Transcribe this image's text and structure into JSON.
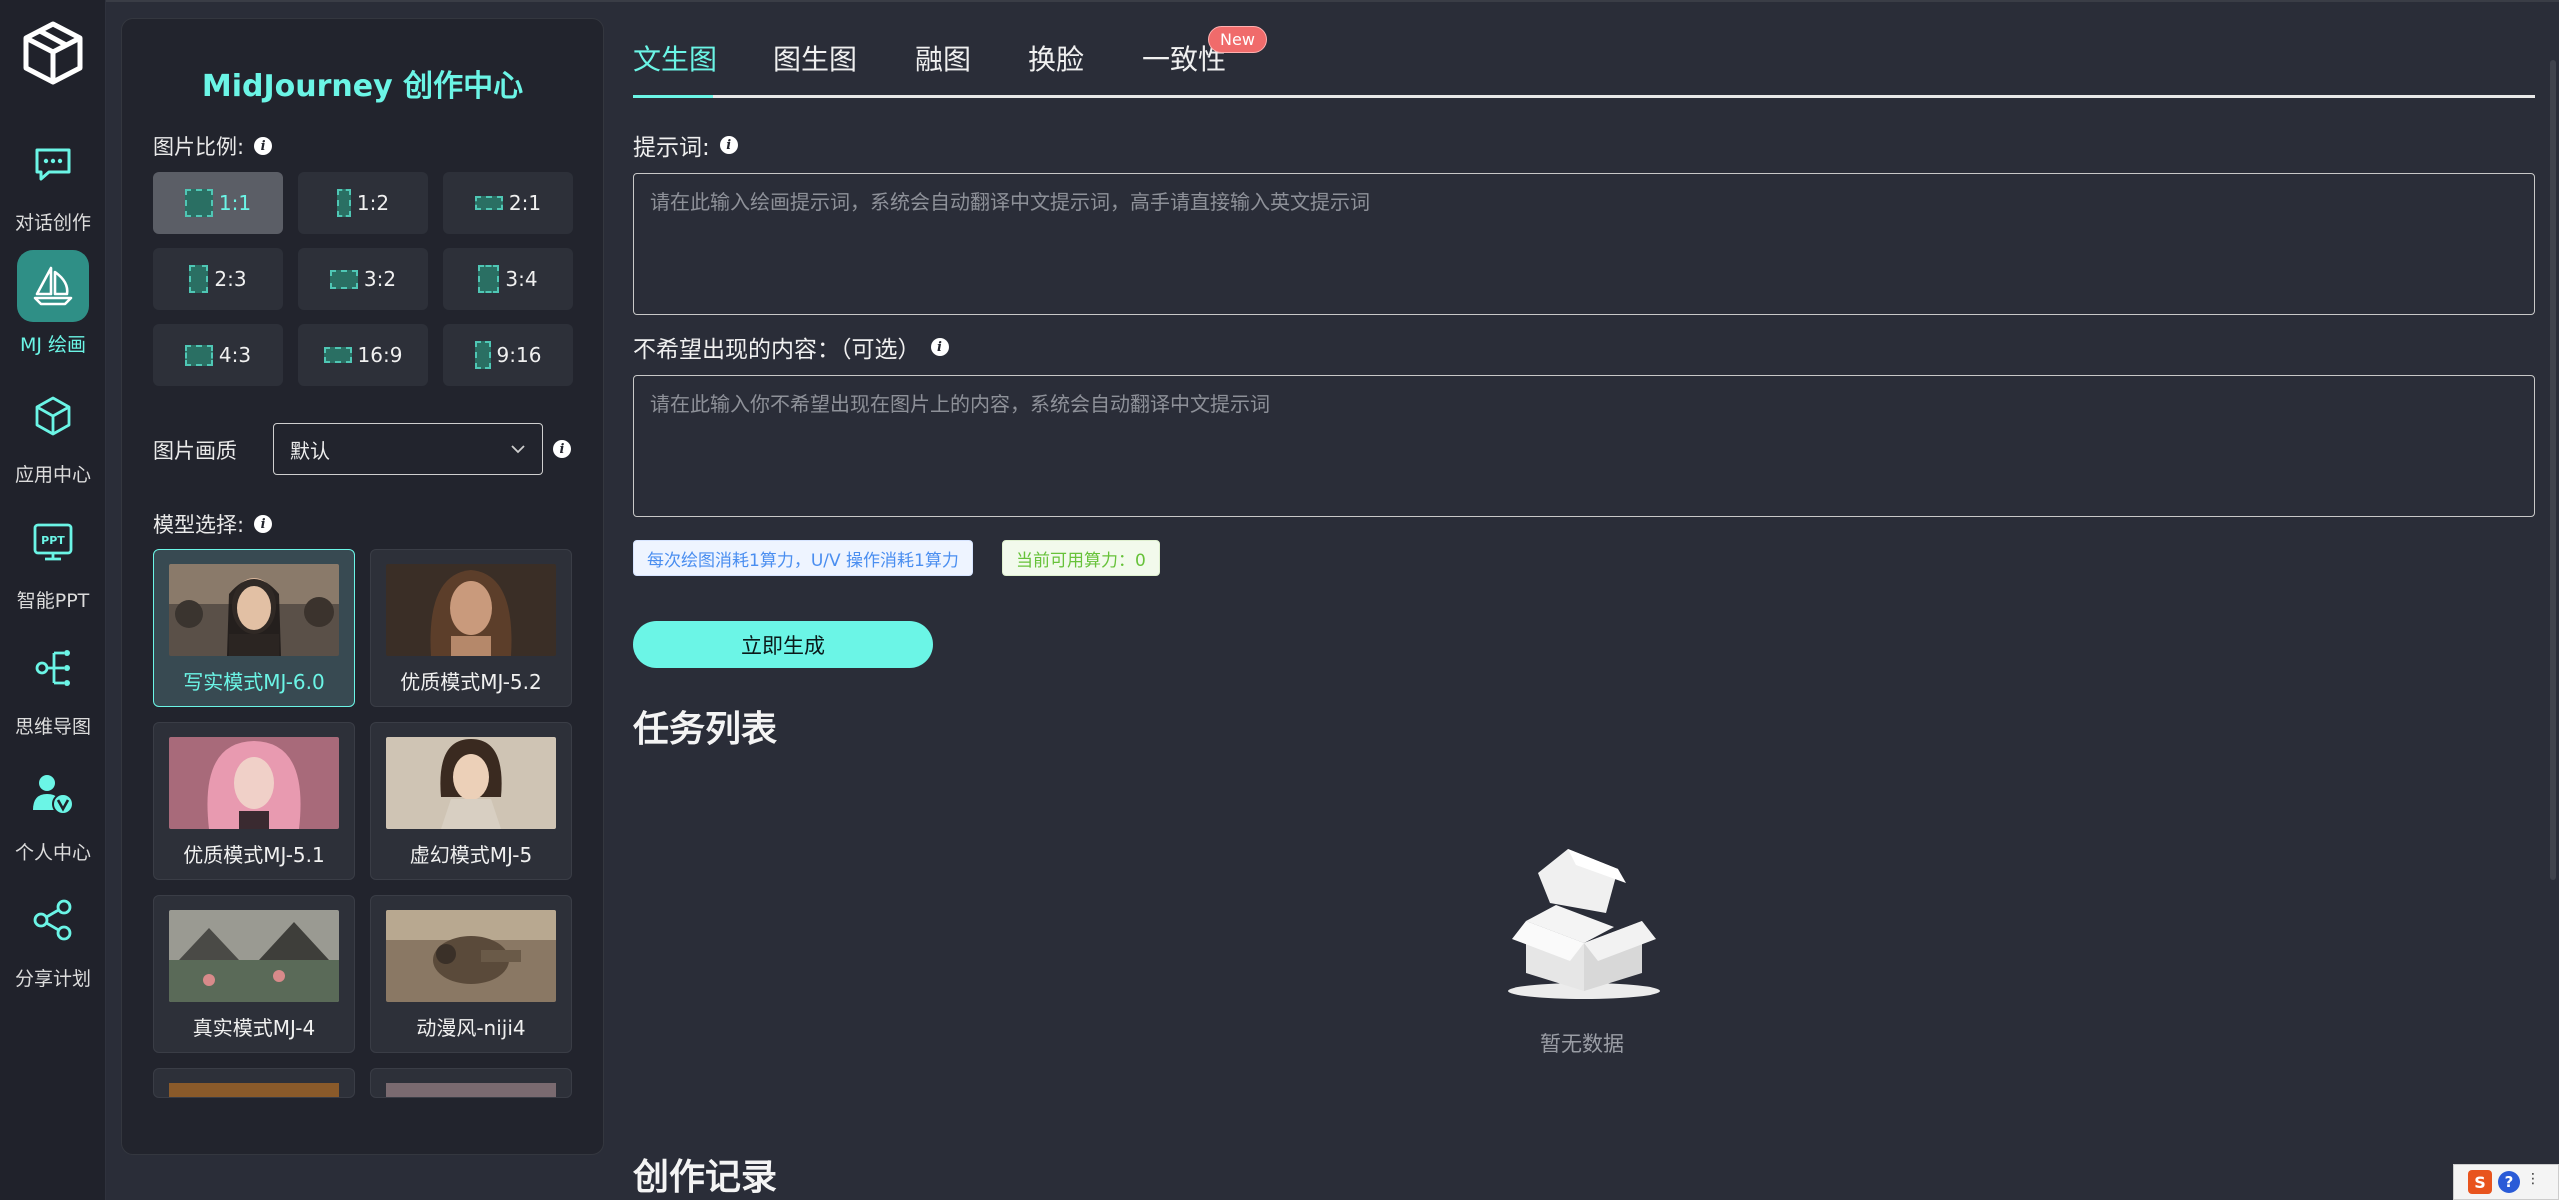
{
  "nav": {
    "items": [
      {
        "label": "对话创作",
        "icon": "chat-icon",
        "active": false
      },
      {
        "label": "MJ 绘画",
        "icon": "sailboat-icon",
        "active": true
      },
      {
        "label": "应用中心",
        "icon": "cube-icon",
        "active": false
      },
      {
        "label": "智能PPT",
        "icon": "ppt-icon",
        "active": false
      },
      {
        "label": "思维导图",
        "icon": "mindmap-icon",
        "active": false
      },
      {
        "label": "个人中心",
        "icon": "user-v-icon",
        "active": false
      },
      {
        "label": "分享计划",
        "icon": "share-icon",
        "active": false
      }
    ]
  },
  "panel": {
    "title": "MidJourney 创作中心",
    "ratio_label": "图片比例:",
    "ratios": [
      "1:1",
      "1:2",
      "2:1",
      "2:3",
      "3:2",
      "3:4",
      "4:3",
      "16:9",
      "9:16"
    ],
    "selected_ratio": "1:1",
    "quality_label": "图片画质",
    "quality_value": "默认",
    "model_label": "模型选择:",
    "models": [
      {
        "label": "写实模式MJ-6.0",
        "active": true
      },
      {
        "label": "优质模式MJ-5.2",
        "active": false
      },
      {
        "label": "优质模式MJ-5.1",
        "active": false
      },
      {
        "label": "虚幻模式MJ-5",
        "active": false
      },
      {
        "label": "真实模式MJ-4",
        "active": false
      },
      {
        "label": "动漫风-niji4",
        "active": false
      }
    ]
  },
  "tabs": [
    {
      "label": "文生图",
      "active": true
    },
    {
      "label": "图生图",
      "active": false
    },
    {
      "label": "融图",
      "active": false
    },
    {
      "label": "换脸",
      "active": false
    },
    {
      "label": "一致性",
      "active": false
    }
  ],
  "new_badge": "New",
  "prompt": {
    "label": "提示词:",
    "placeholder": "请在此输入绘画提示词，系统会自动翻译中文提示词，高手请直接输入英文提示词"
  },
  "negative": {
    "label": "不希望出现的内容：（可选）",
    "placeholder": "请在此输入你不希望出现在图片上的内容，系统会自动翻译中文提示词"
  },
  "tags": {
    "cost": "每次绘图消耗1算力，U/V 操作消耗1算力",
    "balance": "当前可用算力：0"
  },
  "generate_button": "立即生成",
  "task_list": {
    "title": "任务列表",
    "empty_text": "暂无数据"
  },
  "history_title": "创作记录",
  "colors": {
    "accent": "#6bf5e6",
    "background": "#2a2d38",
    "rail": "#20222b",
    "panel": "#22242d"
  }
}
